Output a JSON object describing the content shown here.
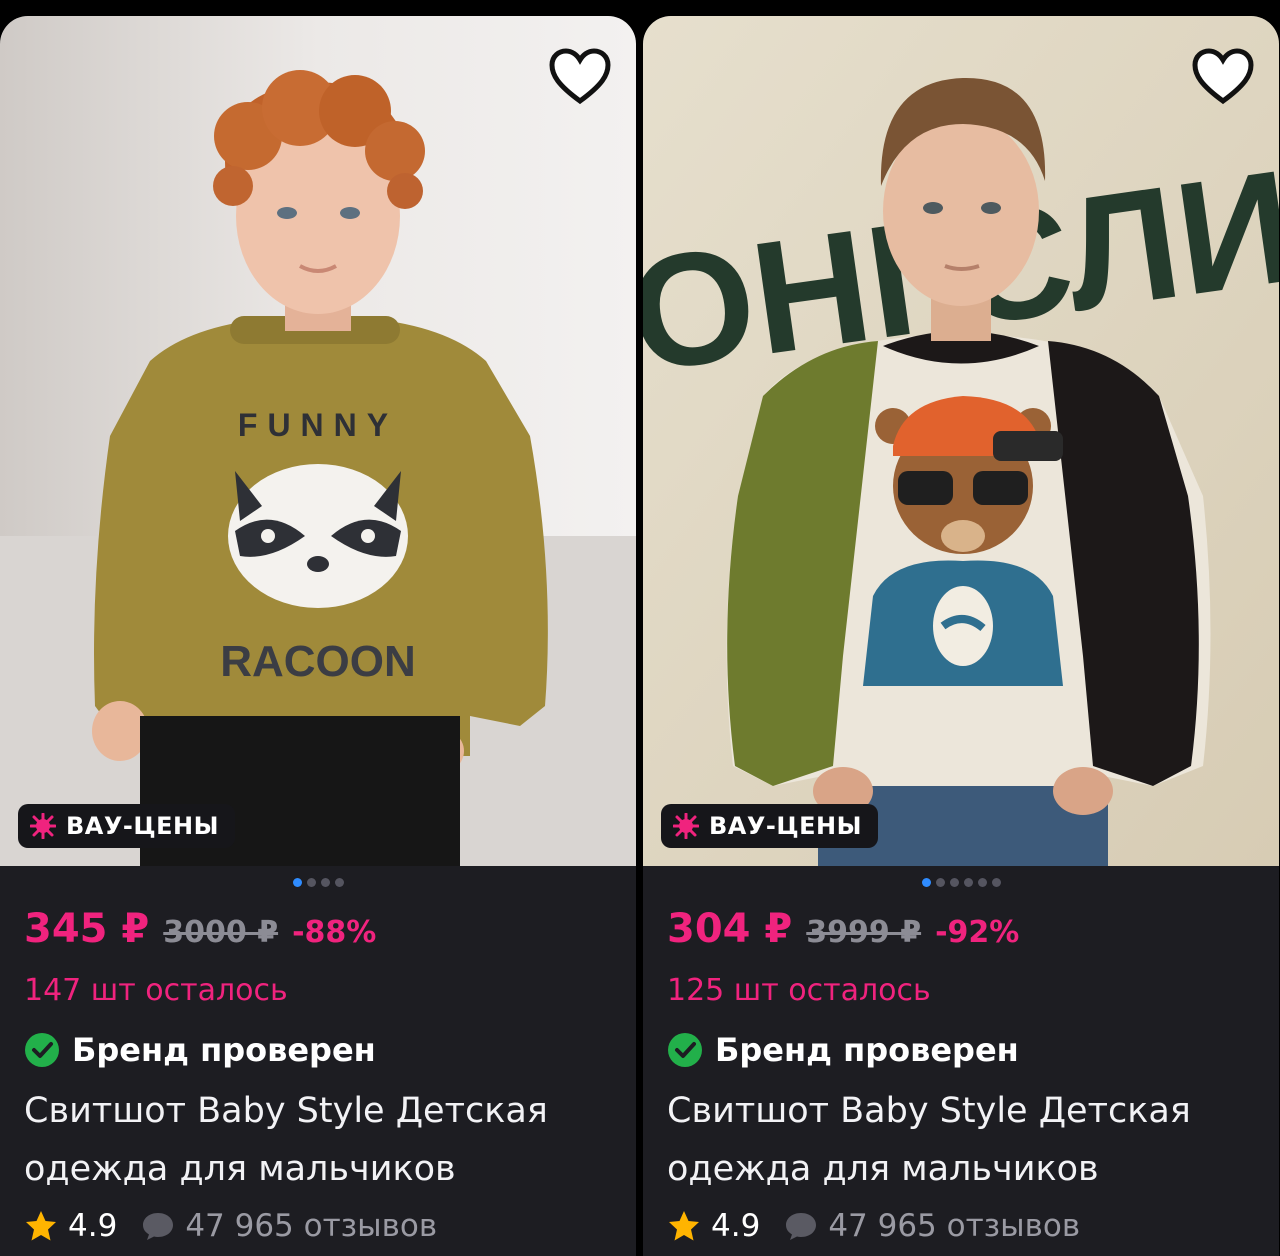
{
  "cards": [
    {
      "badge": "ВАУ-ЦЕНЫ",
      "price": "345 ₽",
      "old_price": "3000 ₽",
      "discount": "-88%",
      "stock": "147 шт осталось",
      "brand": "Бренд проверен",
      "title_line1": "Свитшот Baby Style Детская",
      "title_line2": "одежда для мальчиков",
      "rating": "4.9",
      "reviews": "47 965 отзывов",
      "dots_total": 4,
      "dots_active": 0,
      "sweater_print_top": "FUNNY",
      "sweater_print_bottom": "RACOON"
    },
    {
      "badge": "ВАУ-ЦЕНЫ",
      "price": "304 ₽",
      "old_price": "3999 ₽",
      "discount": "-92%",
      "stock": "125 шт осталось",
      "brand": "Бренд проверен",
      "title_line1": "Свитшот Baby Style Детская",
      "title_line2": "одежда для мальчиков",
      "rating": "4.9",
      "reviews": "47 965 отзывов",
      "dots_total": 6,
      "dots_active": 0,
      "wall_text": "ЛОНГСЛИВ"
    }
  ],
  "colors": {
    "accent_pink": "#f0237e",
    "verified_green": "#22b04a",
    "star_yellow": "#ffb400",
    "dot_active": "#2f8cff"
  }
}
